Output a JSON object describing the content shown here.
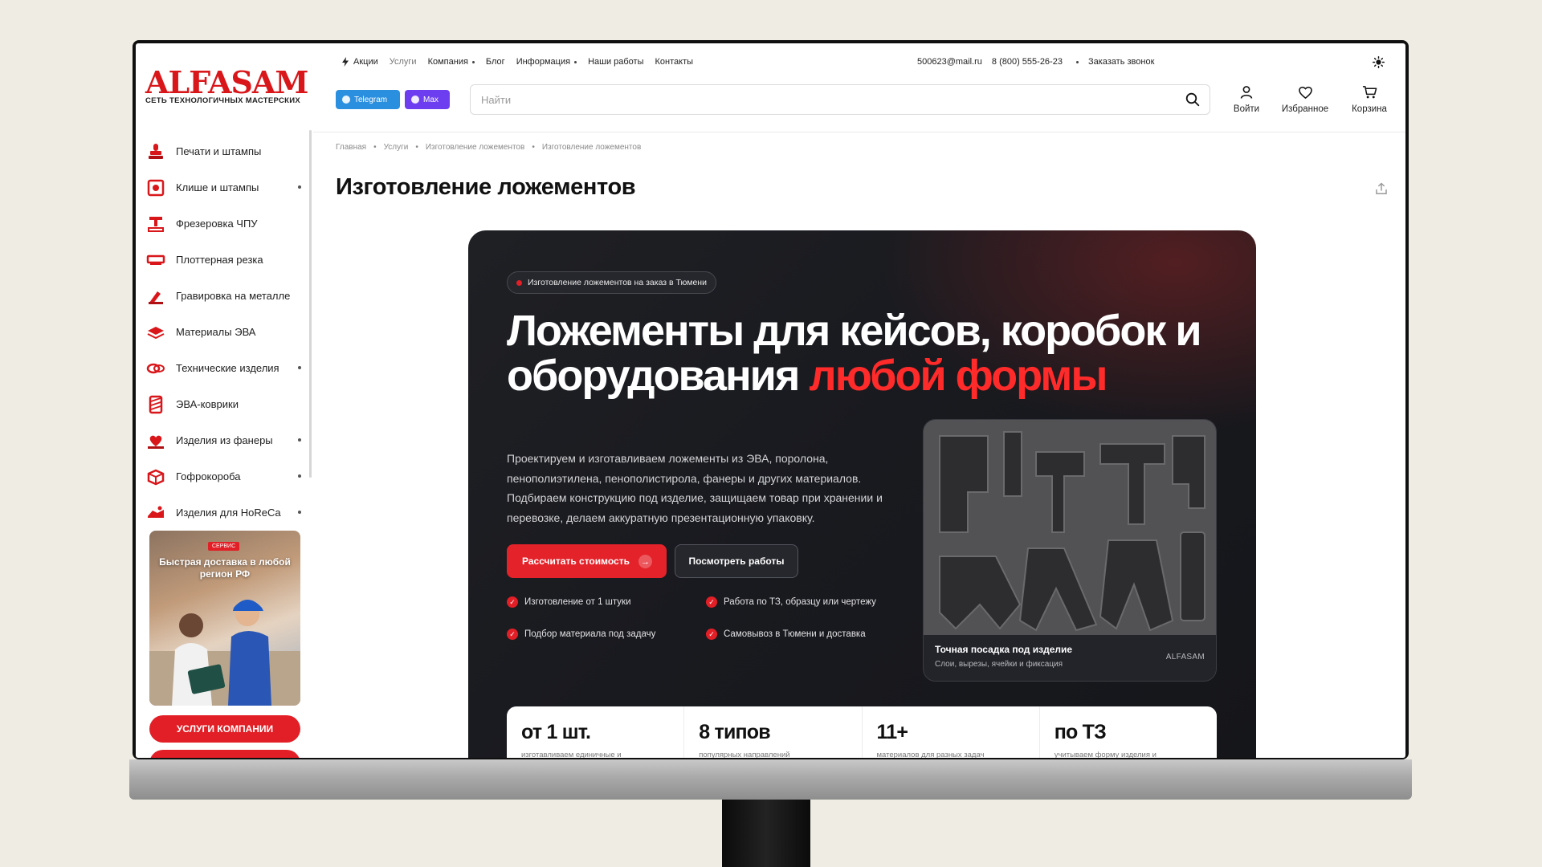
{
  "brand": {
    "name": "ALFASAM",
    "tagline": "СЕТЬ ТЕХНОЛОГИЧНЫХ МАСТЕРСКИХ",
    "accent": "#e21f26"
  },
  "topnav": {
    "items": [
      {
        "label": "Акции"
      },
      {
        "label": "Услуги"
      },
      {
        "label": "Компания"
      },
      {
        "label": "Блог"
      },
      {
        "label": "Информация"
      },
      {
        "label": "Наши работы"
      },
      {
        "label": "Контакты"
      }
    ],
    "email": "500623@mail.ru",
    "phone": "8 (800) 555-26-23",
    "callback": "Заказать звонок"
  },
  "messengers": {
    "telegram": "Telegram",
    "max": "Max"
  },
  "search": {
    "placeholder": "Найти",
    "value": ""
  },
  "actions": {
    "login": "Войти",
    "favorites": "Избранное",
    "cart": "Корзина"
  },
  "sidebar": {
    "items": [
      {
        "label": "Печати и штампы",
        "icon": "stamp-icon"
      },
      {
        "label": "Клише и штампы",
        "icon": "cliche-icon"
      },
      {
        "label": "Фрезеровка ЧПУ",
        "icon": "cnc-icon"
      },
      {
        "label": "Плоттерная резка",
        "icon": "plotter-icon"
      },
      {
        "label": "Гравировка на металле",
        "icon": "engraving-icon"
      },
      {
        "label": "Материалы ЭВА",
        "icon": "eva-material-icon"
      },
      {
        "label": "Технические изделия",
        "icon": "technical-icon"
      },
      {
        "label": "ЭВА-коврики",
        "icon": "eva-mat-icon"
      },
      {
        "label": "Изделия из фанеры",
        "icon": "plywood-icon"
      },
      {
        "label": "Гофрокороба",
        "icon": "box-icon"
      },
      {
        "label": "Изделия для HoReCa",
        "icon": "horeca-icon"
      }
    ],
    "promo": {
      "tag": "СЕРВИС",
      "title": "Быстрая доставка в любой регион РФ"
    },
    "services_button": "УСЛУГИ КОМПАНИИ"
  },
  "breadcrumbs": [
    "Главная",
    "Услуги",
    "Изготовление ложементов",
    "Изготовление ложементов"
  ],
  "page": {
    "title": "Изготовление ложементов"
  },
  "hero": {
    "badge": "Изготовление ложементов на заказ в Тюмени",
    "title_main": "Ложементы для кейсов, коробок и оборудования ",
    "title_accent": "любой формы",
    "description": "Проектируем и изготавливаем ложементы из ЭВА, поролона, пенополиэтилена, пенополистирола, фанеры и других материалов. Подбираем конструкцию под изделие, защищаем товар при хранении и перевозке, делаем аккуратную презентационную упаковку.",
    "cta_primary": "Рассчитать стоимость",
    "cta_secondary": "Посмотреть работы",
    "features": [
      "Изготовление от 1 штуки",
      "Работа по ТЗ, образцу или чертежу",
      "Подбор материала под задачу",
      "Самовывоз в Тюмени и доставка"
    ],
    "photo": {
      "caption": "Точная посадка под изделие",
      "subcaption": "Слои, вырезы, ячейки и фиксация",
      "brand": "ALFASAM"
    }
  },
  "stats": [
    {
      "value": "от 1 шт.",
      "label": "изготавливаем единичные и"
    },
    {
      "value": "8 типов",
      "label": "популярных направлений"
    },
    {
      "value": "11+",
      "label": "материалов для разных задач"
    },
    {
      "value": "по ТЗ",
      "label": "учитываем форму изделия и"
    }
  ]
}
